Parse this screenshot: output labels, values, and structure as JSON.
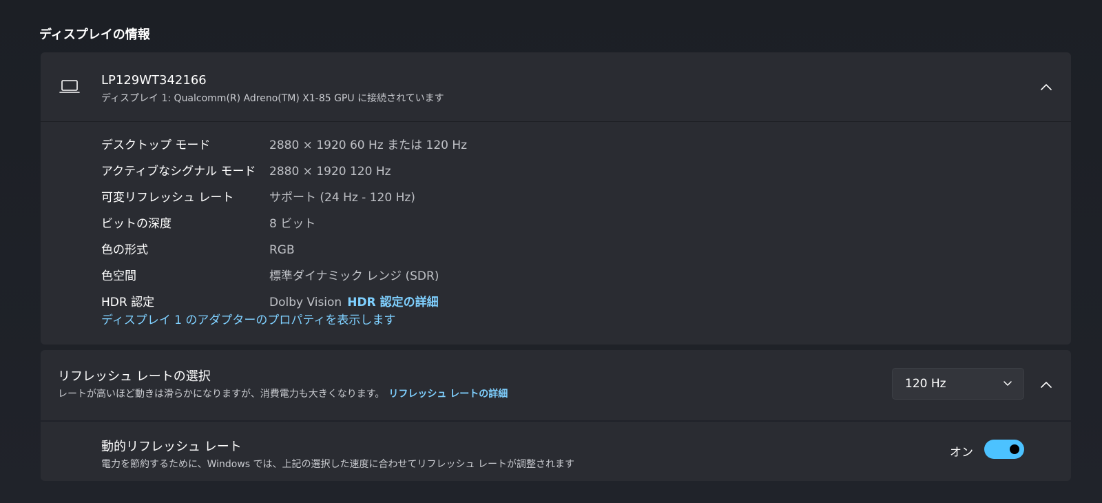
{
  "section": {
    "title": "ディスプレイの情報"
  },
  "display": {
    "name": "LP129WT342166",
    "connection": "ディスプレイ 1: Qualcomm(R) Adreno(TM) X1-85 GPU に接続されています",
    "icon": "laptop-icon",
    "collapse_icon": "chevron-up-icon",
    "properties": [
      {
        "label": "デスクトップ モード",
        "value": "2880 × 1920 60 Hz または 120 Hz"
      },
      {
        "label": "アクティブなシグナル モード",
        "value": "2880 × 1920 120 Hz"
      },
      {
        "label": "可変リフレッシュ レート",
        "value": "サポート (24 Hz - 120 Hz)"
      },
      {
        "label": "ビットの深度",
        "value": "8 ビット"
      },
      {
        "label": "色の形式",
        "value": "RGB"
      },
      {
        "label": "色空間",
        "value": "標準ダイナミック レンジ (SDR)"
      },
      {
        "label": "HDR 認定",
        "value": "Dolby Vision",
        "link": "HDR 認定の詳細"
      }
    ],
    "adapter_link": "ディスプレイ 1 のアダプターのプロパティを表示します"
  },
  "refresh": {
    "title": "リフレッシュ レートの選択",
    "description": "レートが高いほど動きは滑らかになりますが、消費電力も大きくなります。",
    "link": "リフレッシュ レートの詳細",
    "selected": "120 Hz",
    "dropdown_icon": "chevron-down-icon",
    "collapse_icon": "chevron-up-icon"
  },
  "dynamic": {
    "title": "動的リフレッシュ レート",
    "description": "電力を節約するために、Windows では、上記の選択した速度に合わせてリフレッシュ レートが調整されます",
    "toggle_label": "オン",
    "toggle_on": true
  },
  "colors": {
    "accent": "#4cc2ff",
    "link": "#7fd0ff",
    "card": "#2a2c32",
    "background": "#1f2229"
  }
}
